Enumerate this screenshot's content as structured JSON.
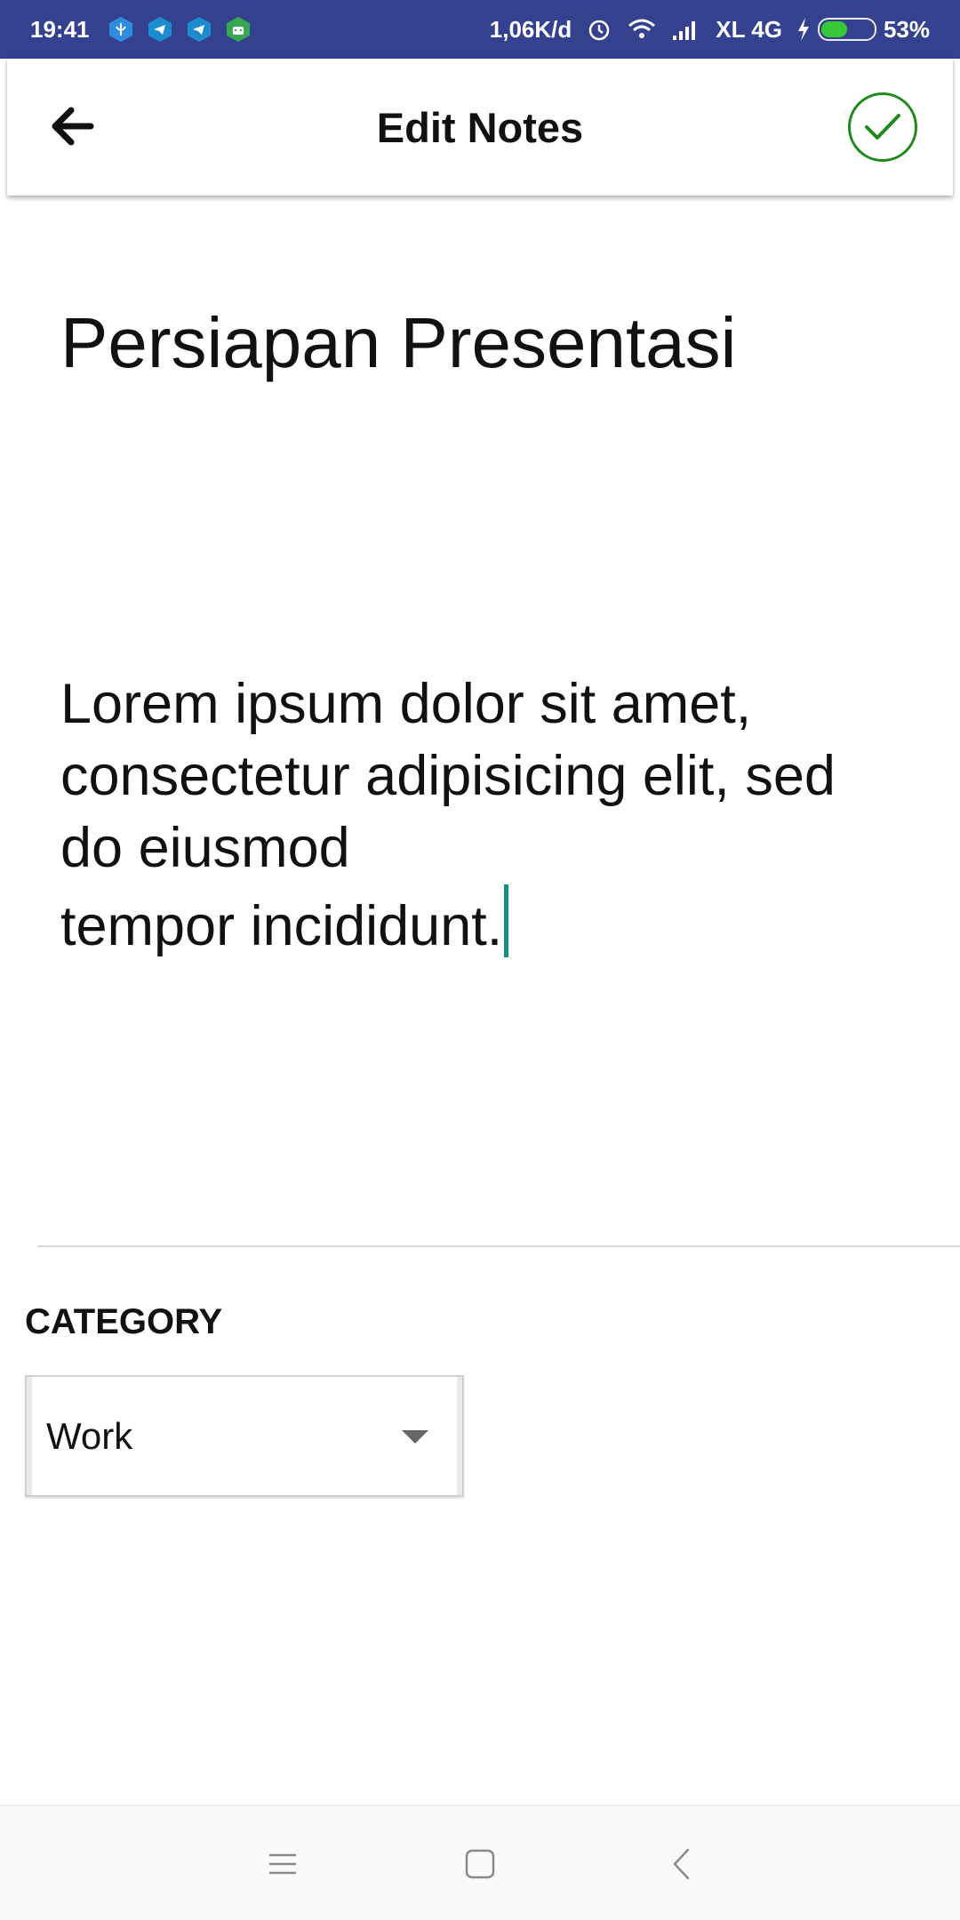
{
  "status_bar": {
    "time": "19:41",
    "network_speed": "1,06K/d",
    "carrier": "XL 4G",
    "battery": "53%",
    "battery_level": 0.53,
    "icons": [
      "vpn-shield-icon",
      "telegram-icon",
      "telegram-icon",
      "android-icon",
      "alarm-icon",
      "wifi-icon",
      "signal-icon",
      "charging-icon",
      "battery-icon"
    ]
  },
  "app_bar": {
    "title": "Edit Notes",
    "back_icon": "arrow-left-icon",
    "confirm_icon": "check-circle-icon"
  },
  "note": {
    "title": "Persiapan Presentasi",
    "body": "Lorem ipsum dolor sit amet,\nconsectetur adipisicing elit, sed\ndo eiusmod\ntempor incididunt."
  },
  "category": {
    "label": "CATEGORY",
    "selected": "Work"
  },
  "nav_bar": {
    "icons": [
      "menu-icon",
      "home-icon",
      "back-icon"
    ]
  },
  "colors": {
    "status_bar": "#33418f",
    "confirm_green": "#1e8a1e",
    "cursor": "#119282"
  }
}
